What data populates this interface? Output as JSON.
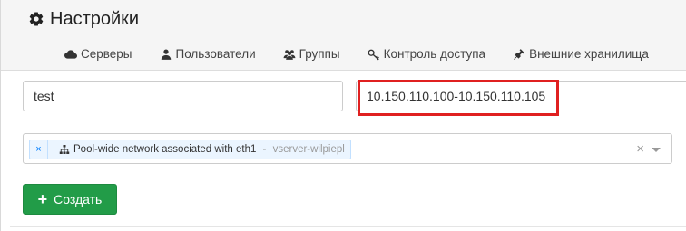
{
  "header": {
    "title": "Настройки",
    "title_icon": "gear-icon"
  },
  "tabs": [
    {
      "label": "Серверы",
      "icon": "cloud-icon"
    },
    {
      "label": "Пользователи",
      "icon": "user-icon"
    },
    {
      "label": "Группы",
      "icon": "users-icon"
    },
    {
      "label": "Контроль доступа",
      "icon": "key-icon"
    },
    {
      "label": "Внешние хранилища",
      "icon": "plug-icon"
    }
  ],
  "form": {
    "name_value": "test",
    "ip_range_value": "10.150.110.100-10.150.110.105",
    "network_tag": {
      "remove_symbol": "×",
      "label": "Pool-wide network associated with eth1",
      "separator": " - ",
      "sub": "vserver-wilpiepl",
      "icon": "network-icon"
    },
    "clear_symbol": "×",
    "create_label": "Создать",
    "create_icon": "plus-icon"
  },
  "colors": {
    "primary_button": "#229c48",
    "highlight": "#e02020",
    "tag_bg": "#ebf5ff",
    "tag_remove": "#007eff"
  }
}
